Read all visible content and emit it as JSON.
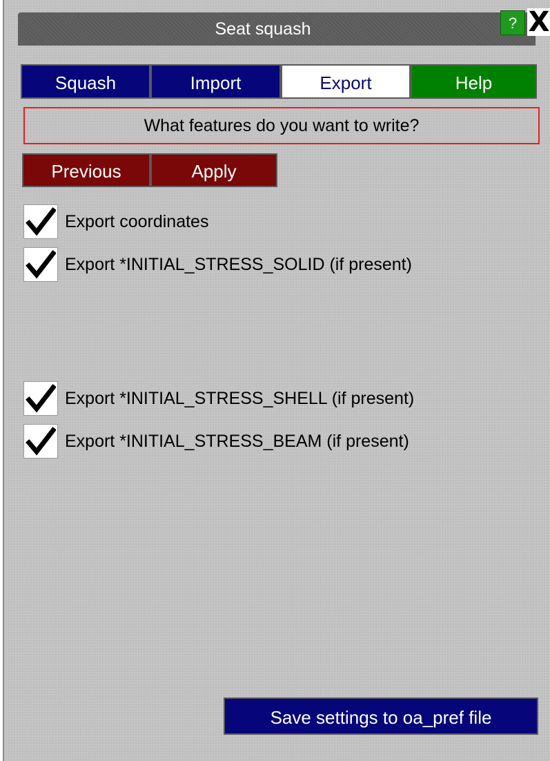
{
  "window": {
    "title": "Seat squash",
    "help_label": "?",
    "close_label": "X"
  },
  "tabs": [
    {
      "label": "Squash"
    },
    {
      "label": "Import"
    },
    {
      "label": "Export"
    },
    {
      "label": "Help"
    }
  ],
  "prompt": "What features do you want to write?",
  "actions": {
    "previous_label": "Previous",
    "apply_label": "Apply"
  },
  "options": [
    {
      "label": "Export coordinates",
      "checked": true
    },
    {
      "label": "Export *INITIAL_STRESS_SOLID (if present)",
      "checked": true
    },
    {
      "label": "Export *INITIAL_STRESS_SHELL (if present)",
      "checked": true
    },
    {
      "label": "Export *INITIAL_STRESS_BEAM (if present)",
      "checked": true
    }
  ],
  "save_button": "Save settings to oa_pref file",
  "colors": {
    "panel_bg": "#c2c2c2",
    "tab_blue": "#06067a",
    "tab_active": "#ffffff",
    "tab_help": "#008000",
    "action_red": "#7a0808",
    "prompt_border": "#e02020"
  }
}
